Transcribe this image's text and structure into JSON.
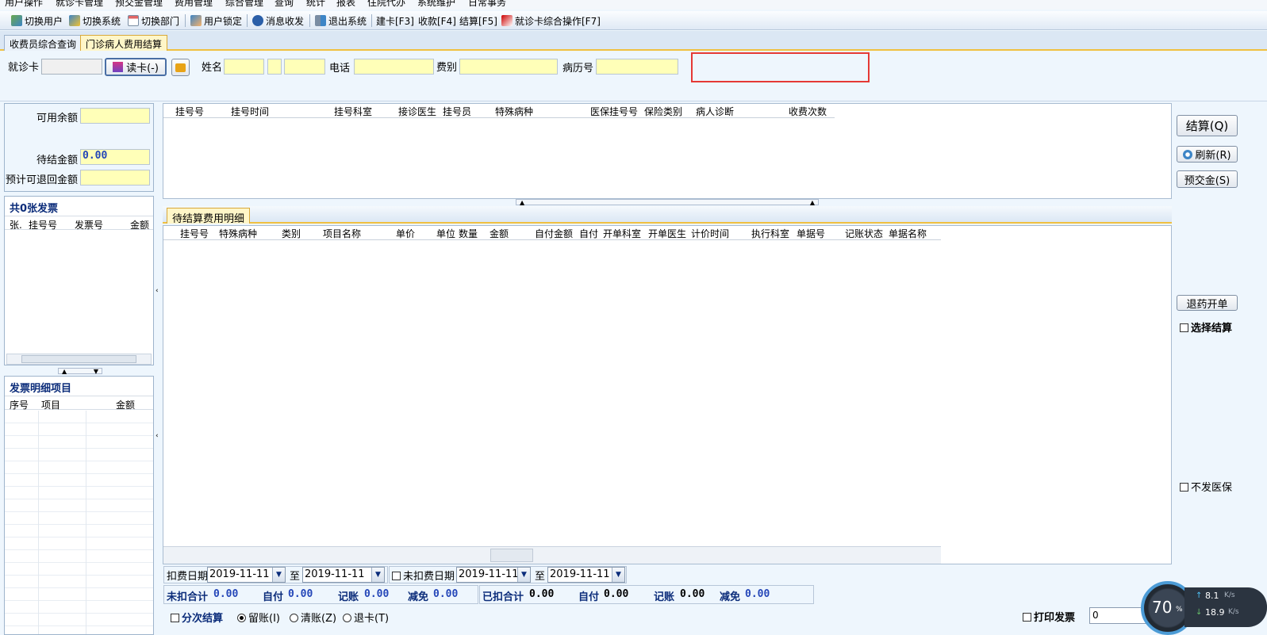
{
  "menu": [
    "用户操作",
    "就诊卡管理",
    "预交金管理",
    "费用管理",
    "综合管理",
    "查询",
    "统计",
    "报表",
    "住院代办",
    "系统维护",
    "日常事务"
  ],
  "toolbar": [
    {
      "label": "切换用户",
      "icon": "users-icon"
    },
    {
      "label": "切换系统",
      "icon": "system-icon"
    },
    {
      "label": "切换部门",
      "icon": "calendar-icon"
    },
    {
      "label": "用户锁定",
      "icon": "lock-icon"
    },
    {
      "label": "消息收发",
      "icon": "info-icon"
    },
    {
      "label": "退出系统",
      "icon": "exit-icon"
    },
    {
      "label": "建卡[F3]",
      "icon": ""
    },
    {
      "label": "收款[F4]",
      "icon": ""
    },
    {
      "label": "结算[F5]",
      "icon": ""
    },
    {
      "label": "就诊卡综合操作[F7]",
      "icon": "card-icon"
    }
  ],
  "tabs": [
    {
      "label": "收费员综合查询",
      "active": false
    },
    {
      "label": "门诊病人费用结算",
      "active": true
    }
  ],
  "filter": {
    "card_label": "就诊卡",
    "read_card": "读卡(-)",
    "name_label": "姓名",
    "phone_label": "电话",
    "fee_type_label": "费别",
    "record_no_label": "病历号"
  },
  "balance": {
    "available_label": "可用余额",
    "available_value": "",
    "pending_label": "待结金额",
    "pending_value": "0.00",
    "refund_label": "预计可退回金额",
    "refund_value": ""
  },
  "invoices": {
    "title": "共0张发票",
    "columns": [
      "张.",
      "挂号号",
      "发票号",
      "金额"
    ]
  },
  "invoice_items": {
    "title": "发票明细项目",
    "columns": [
      "序号",
      "项目",
      "金额"
    ]
  },
  "registration": {
    "columns": [
      "挂号号",
      "挂号时间",
      "挂号科室",
      "接诊医生",
      "挂号员",
      "特殊病种",
      "医保挂号号",
      "保险类别",
      "病人诊断",
      "收费次数"
    ]
  },
  "detail": {
    "tab": "待结算费用明细",
    "columns": [
      "挂号号",
      "特殊病种",
      "类别",
      "项目名称",
      "单价",
      "单位",
      "数量",
      "金额",
      "自付金额",
      "自付",
      "开单科室",
      "开单医生",
      "计价时间",
      "执行科室",
      "单据号",
      "记账状态",
      "单据名称"
    ]
  },
  "dates": {
    "deduct_label": "扣费日期",
    "deduct_from": "2019-11-11",
    "to1": "至",
    "deduct_to": "2019-11-11",
    "undeduct_label": "未扣费日期",
    "undeduct_from": "2019-11-11",
    "to2": "至",
    "undeduct_to": "2019-11-11"
  },
  "summary": {
    "undeducted": [
      {
        "label": "未扣合计",
        "value": "0.00"
      },
      {
        "label": "自付",
        "value": "0.00"
      },
      {
        "label": "记账",
        "value": "0.00"
      },
      {
        "label": "减免",
        "value": "0.00"
      }
    ],
    "deducted": [
      {
        "label": "已扣合计",
        "value": "0.00"
      },
      {
        "label": "自付",
        "value": "0.00"
      },
      {
        "label": "记账",
        "value": "0.00"
      },
      {
        "label": "减免",
        "value": "0.00"
      }
    ]
  },
  "bottom": {
    "split": "分次结算",
    "opt1": "留账(I)",
    "opt2": "清账(Z)",
    "opt3": "退卡(T)",
    "print": "打印发票",
    "print_value": "0"
  },
  "right": {
    "settle": "结算(Q)",
    "refresh": "刷新(R)",
    "prepay": "预交金(S)",
    "return_drug": "退药开单",
    "select_settle": "选择结算",
    "no_insurance": "不发医保"
  },
  "overlay": {
    "percent": "70",
    "unit": "%",
    "up": "8.1",
    "down": "18.9",
    "speed_unit": "K/s"
  },
  "colors": {
    "accent": "#0b2c7a",
    "yellow_input": "#ffffb8",
    "tab_active": "#fff6c8",
    "highlight_box": "#e53935"
  }
}
